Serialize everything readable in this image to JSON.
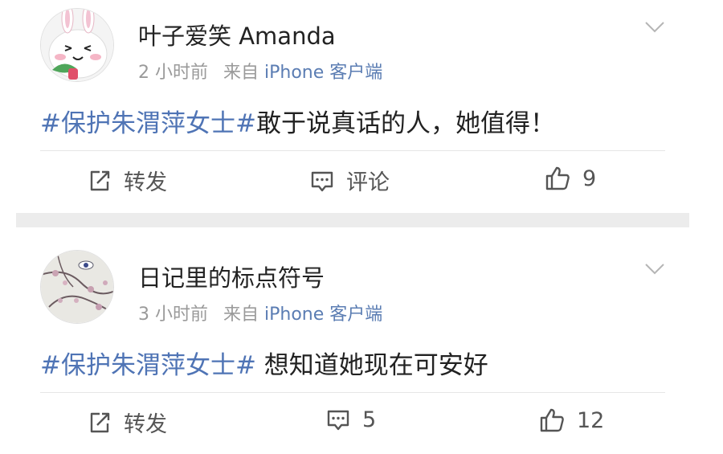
{
  "posts": [
    {
      "username": "叶子爱笑 Amanda",
      "time": "2 小时前",
      "source_prefix": "来自",
      "source": "iPhone 客户端",
      "hashtag": "#保护朱渭萍女士#",
      "text": "敢于说真话的人，她值得！",
      "actions": {
        "repost": "转发",
        "comment": "评论",
        "like": "9"
      }
    },
    {
      "username": "日记里的标点符号",
      "time": "3 小时前",
      "source_prefix": "来自",
      "source": "iPhone 客户端",
      "hashtag": "#保护朱渭萍女士#",
      "text": " 想知道她现在可安好",
      "actions": {
        "repost": "转发",
        "comment": "5",
        "like": "12"
      }
    }
  ],
  "colors": {
    "hashtag": "#4f74b5",
    "source": "#5b7db3",
    "meta": "#9a9a9a",
    "separator": "#ececec"
  },
  "icons": {
    "repost": "share-square-icon",
    "comment": "comment-bubble-icon",
    "like": "thumbs-up-icon",
    "more": "chevron-down-icon"
  }
}
